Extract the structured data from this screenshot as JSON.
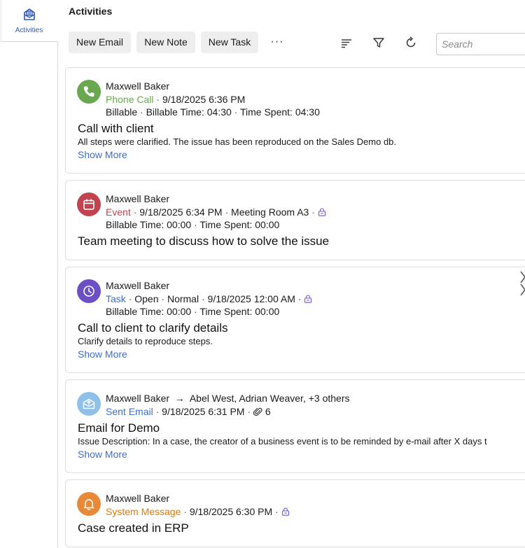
{
  "sidenav": {
    "tab_label": "Activities"
  },
  "header": {
    "title": "Activities"
  },
  "toolbar": {
    "new_email": "New Email",
    "new_note": "New Note",
    "new_task": "New Task",
    "more": "···",
    "icons": [
      "sort-icon",
      "filter-icon",
      "refresh-icon"
    ]
  },
  "search": {
    "placeholder": "Search"
  },
  "colors": {
    "phone": "#6aa84f",
    "event": "#c0434f",
    "task": "#6a4fc7",
    "email": "#8fc0ea",
    "system": "#e8893a",
    "link": "#3e6dd6"
  },
  "activities": [
    {
      "author": "Maxwell Baker",
      "type": "Phone Call",
      "date": "9/18/2025 6:36 PM",
      "billable": "Billable",
      "billable_time": "Billable Time: 04:30",
      "time_spent": "Time Spent: 04:30",
      "subject": "Call with client",
      "body": "All steps were clarified. The issue has been reproduced on the Sales Demo db.",
      "show_more": "Show More"
    },
    {
      "author": "Maxwell Baker",
      "type": "Event",
      "date": "9/18/2025 6:34 PM",
      "location": "Meeting Room A3",
      "billable_time": "Billable Time: 00:00",
      "time_spent": "Time Spent: 00:00",
      "subject": "Team meeting to discuss how to solve the issue"
    },
    {
      "author": "Maxwell Baker",
      "type": "Task",
      "status": "Open",
      "priority": "Normal",
      "date": "9/18/2025 12:00 AM",
      "billable_time": "Billable Time: 00:00",
      "time_spent": "Time Spent: 00:00",
      "subject": "Call to client to clarify details",
      "body": "Clarify details to reproduce steps.",
      "show_more": "Show More"
    },
    {
      "author": "Maxwell Baker",
      "recipients": "Abel West, Adrian Weaver, +3 others",
      "type": "Sent Email",
      "date": "9/18/2025 6:31 PM",
      "attachments": "6",
      "subject": "Email for Demo",
      "body": "Issue Description: In a case, the creator of a business event is to be reminded by e-mail after X days t",
      "show_more": "Show More"
    },
    {
      "author": "Maxwell Baker",
      "type": "System Message",
      "date": "9/18/2025 6:30 PM",
      "subject": "Case created in ERP"
    }
  ]
}
